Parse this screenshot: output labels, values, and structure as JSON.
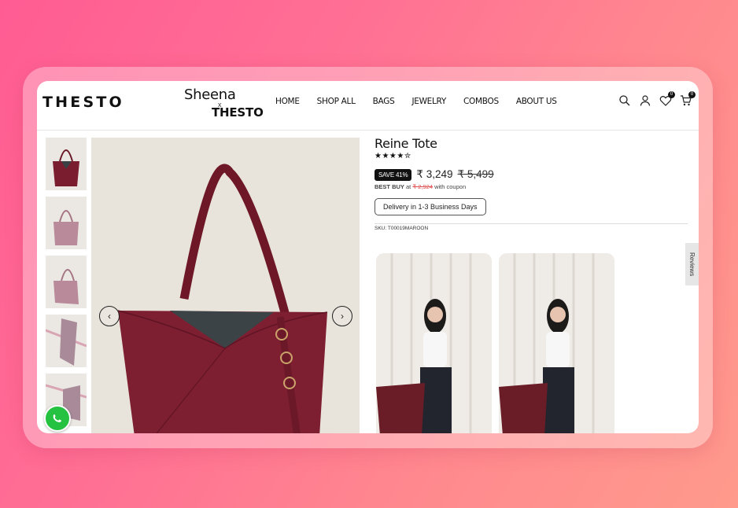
{
  "brand": {
    "logo": "THESTO",
    "collab_top": "Sheena",
    "collab_x": "x",
    "collab_bottom": "THESTO"
  },
  "nav": [
    "HOME",
    "SHOP ALL",
    "BAGS",
    "JEWELRY",
    "COMBOS",
    "ABOUT US"
  ],
  "header_icons": {
    "wishlist_count": "0",
    "cart_count": "0"
  },
  "product": {
    "title": "Reine Tote",
    "rating": 4.5,
    "stars": "★★★★✮",
    "save_badge": "SAVE 41%",
    "price": "₹ 3,249",
    "original_price": "₹ 5,499",
    "best_buy_label": "BEST BUY",
    "best_buy_at": "at",
    "best_buy_price": "₹ 2,924",
    "best_buy_suffix": "with coupon",
    "delivery": "Delivery in 1-3 Business Days",
    "sku": "SKU: T00019MAROON"
  },
  "gallery": {
    "thumb_count": 5,
    "prev": "‹",
    "next": "›"
  },
  "reviews_tab": "Reviews",
  "colors": {
    "maroon": "#7a1d2e",
    "accent_bg_start": "#ff5c93",
    "accent_bg_end": "#ff9a8c"
  }
}
